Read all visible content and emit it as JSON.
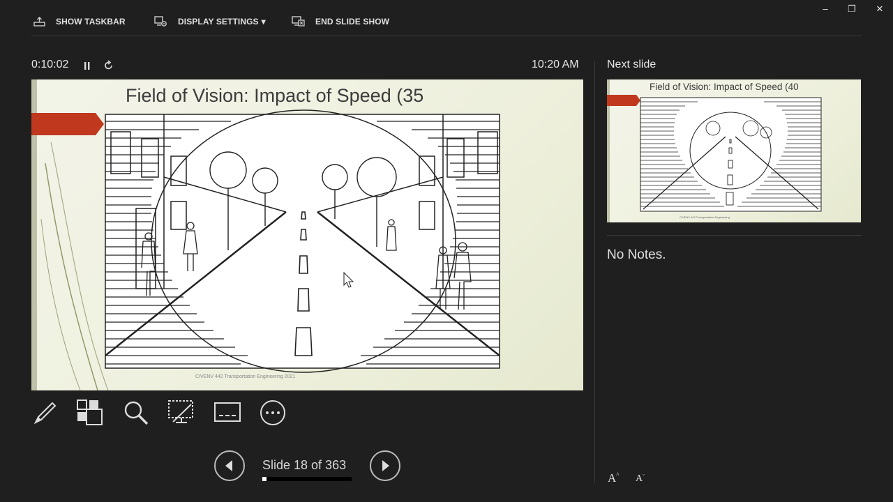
{
  "toolbar": {
    "show_taskbar": "SHOW TASKBAR",
    "display_settings": "DISPLAY SETTINGS",
    "display_settings_caret": "▾",
    "end_slide_show": "END SLIDE SHOW"
  },
  "window": {
    "minimize": "–",
    "restore": "❐",
    "close": "✕"
  },
  "presenter": {
    "elapsed_time": "0:10:02",
    "clock": "10:20 AM"
  },
  "current_slide": {
    "title": "Field of Vision: Impact of Speed (35",
    "footer": "CIVENV 442 Transportation Engineering   2021"
  },
  "navigation": {
    "slide_counter": "Slide 18 of 363",
    "progress": 0.05
  },
  "next_slide": {
    "label": "Next slide",
    "title": "Field of Vision: Impact of Speed (40"
  },
  "notes": {
    "text": "No Notes."
  },
  "font_controls": {
    "increase": "A",
    "decrease": "A"
  },
  "colors": {
    "background": "#1f1f1f",
    "accent_arrow": "#c0391f"
  },
  "icons": [
    "taskbar-icon",
    "display-settings-icon",
    "end-show-icon",
    "pause-icon",
    "restart-icon",
    "pen-icon",
    "all-slides-icon",
    "zoom-icon",
    "black-screen-icon",
    "subtitles-icon",
    "more-options-icon",
    "previous-icon",
    "next-icon",
    "mouse-pointer-icon"
  ]
}
